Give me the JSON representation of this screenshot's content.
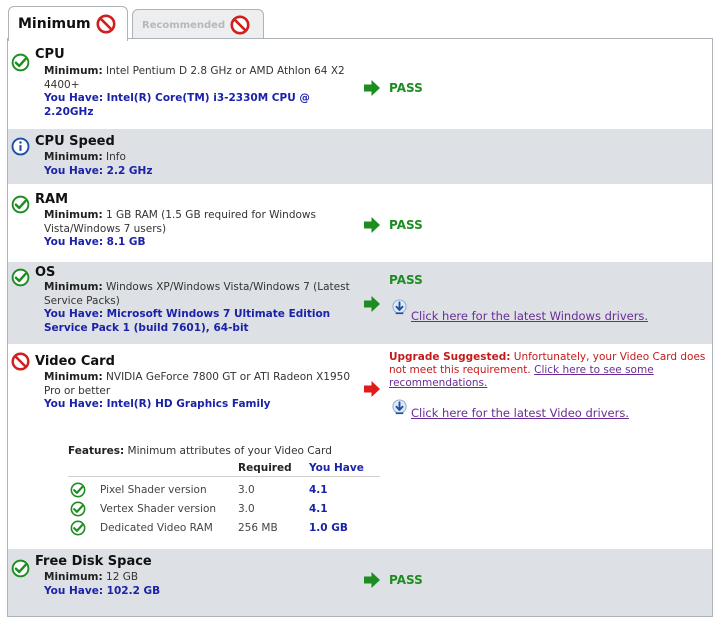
{
  "tabs": [
    {
      "label": "Minimum",
      "active": true,
      "icon": "prohibited-icon"
    },
    {
      "label": "Recommended",
      "active": false,
      "icon": "prohibited-icon"
    }
  ],
  "colors": {
    "pass_green": "#1d8d22",
    "fail_red": "#cc1f1f",
    "have_blue": "#1a22a8",
    "link_purple": "#6a2c94",
    "shaded_row": "#dde0e5"
  },
  "requirements": {
    "cpu": {
      "title": "CPU",
      "status": "pass",
      "min_label": "Minimum:",
      "min_value": "Intel Pentium D 2.8 GHz or AMD Athlon 64 X2 4400+",
      "have": "You Have: Intel(R) Core(TM) i3-2330M CPU @ 2.20GHz",
      "result": "PASS"
    },
    "cpu_speed": {
      "title": "CPU Speed",
      "status": "info",
      "min_label": "Minimum:",
      "min_value": "Info",
      "have": "You Have: 2.2 GHz"
    },
    "ram": {
      "title": "RAM",
      "status": "pass",
      "min_label": "Minimum:",
      "min_value": "1 GB RAM (1.5 GB required for Windows Vista/Windows 7 users)",
      "have": "You Have: 8.1 GB",
      "result": "PASS"
    },
    "os": {
      "title": "OS",
      "status": "pass",
      "min_label": "Minimum:",
      "min_value": "Windows XP/Windows Vista/Windows 7 (Latest Service Packs)",
      "have": "You Have: Microsoft Windows 7 Ultimate Edition Service Pack 1 (build 7601), 64-bit",
      "result": "PASS",
      "driver_link": "Click here for the latest Windows drivers."
    },
    "video": {
      "title": "Video Card",
      "status": "fail",
      "min_label": "Minimum:",
      "min_value": "NVIDIA GeForce 7800 GT or ATI Radeon X1950 Pro or better",
      "have": "You Have: Intel(R) HD Graphics Family",
      "upgrade_label": "Upgrade Suggested:",
      "upgrade_text": " Unfortunately, your Video Card does not meet this requirement. ",
      "upgrade_link": "Click here to see some recommendations.",
      "driver_link": "Click here for the latest Video drivers.",
      "features": {
        "title_label": "Features:",
        "title_text": " Minimum attributes of your Video Card",
        "col_required": "Required",
        "col_have": "You Have",
        "rows": [
          {
            "name": "Pixel Shader version",
            "required": "3.0",
            "have": "4.1"
          },
          {
            "name": "Vertex Shader version",
            "required": "3.0",
            "have": "4.1"
          },
          {
            "name": "Dedicated Video RAM",
            "required": "256 MB",
            "have": "1.0 GB"
          }
        ]
      }
    },
    "disk": {
      "title": "Free Disk Space",
      "status": "pass",
      "min_label": "Minimum:",
      "min_value": "12 GB",
      "have": "You Have: 102.2 GB",
      "result": "PASS"
    }
  }
}
